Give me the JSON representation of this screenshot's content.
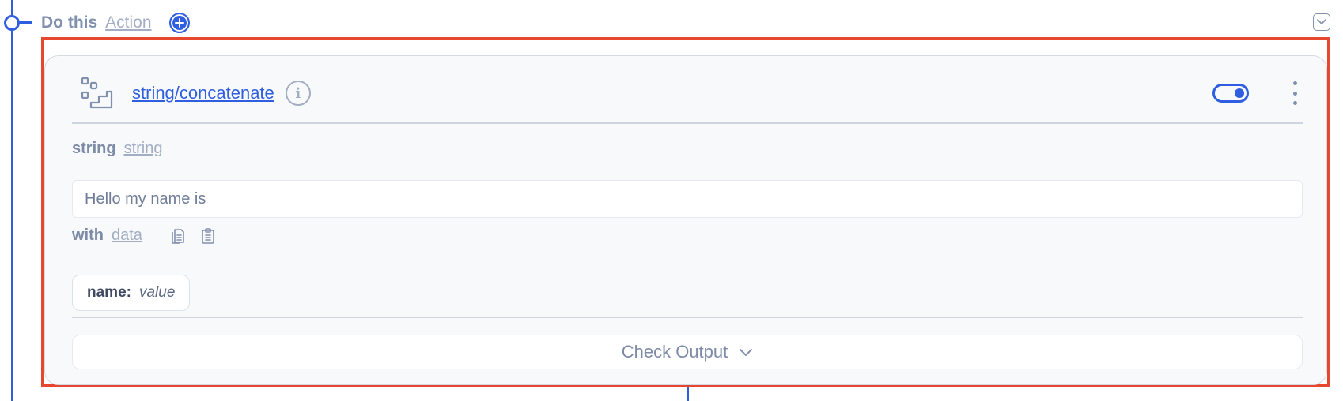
{
  "section": {
    "title": "Do this",
    "type_link": "Action"
  },
  "action": {
    "function_name": "string/concatenate",
    "enabled": true,
    "params": {
      "string": {
        "name": "string",
        "type": "string",
        "value": "Hello my name is"
      },
      "with": {
        "name": "with",
        "type": "data",
        "entries": [
          {
            "key": "name:",
            "value": "value"
          }
        ]
      }
    },
    "check_output_label": "Check Output"
  },
  "colors": {
    "accent": "#2f5ee0",
    "highlight": "#e8472f",
    "muted": "#8190ad"
  }
}
